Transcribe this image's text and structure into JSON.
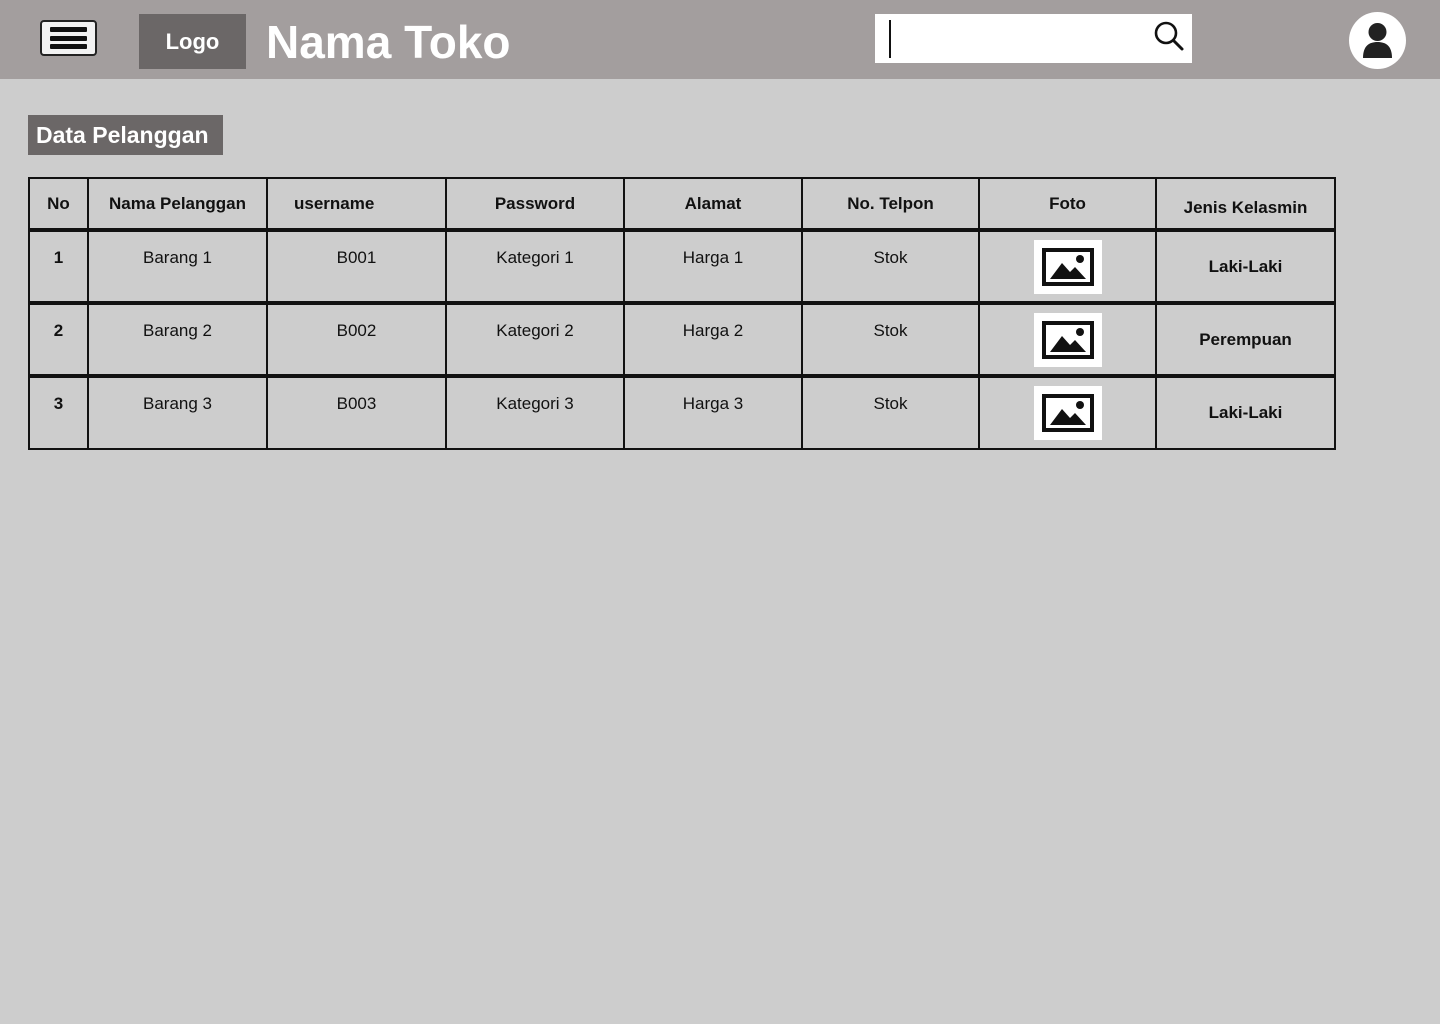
{
  "header": {
    "logo_label": "Logo",
    "store_name": "Nama Toko",
    "search": {
      "value": "",
      "placeholder": ""
    }
  },
  "section_title": "Data Pelanggan",
  "table": {
    "headers": [
      "No",
      "Nama Pelanggan",
      "username",
      "Password",
      "Alamat",
      "No. Telpon",
      "Foto",
      "Jenis Kelasmin"
    ],
    "rows": [
      {
        "no": "1",
        "name": "Barang 1",
        "username": "B001",
        "password": "Kategori 1",
        "address": "Harga 1",
        "phone": "Stok",
        "photo_icon": "image-icon",
        "gender": "Laki-Laki"
      },
      {
        "no": "2",
        "name": "Barang 2",
        "username": "B002",
        "password": "Kategori 2",
        "address": "Harga 2",
        "phone": "Stok",
        "photo_icon": "image-icon",
        "gender": "Perempuan"
      },
      {
        "no": "3",
        "name": "Barang 3",
        "username": "B003",
        "password": "Kategori 3",
        "address": "Harga 3",
        "phone": "Stok",
        "photo_icon": "image-icon",
        "gender": "Laki-Laki"
      }
    ]
  },
  "icons": {
    "menu": "hamburger-menu-icon",
    "search": "search-icon",
    "avatar": "user-avatar-icon"
  },
  "colors": {
    "topbar": "#a39e9e",
    "background": "#cdcdcd",
    "accent_box": "#6b6767"
  }
}
